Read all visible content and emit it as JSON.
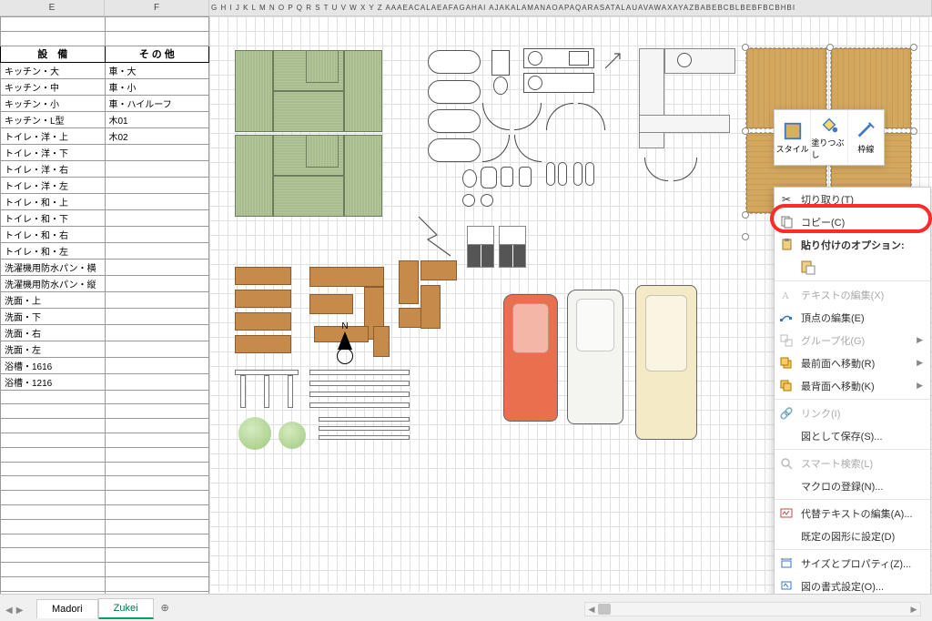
{
  "columns": {
    "E": "E",
    "F": "F",
    "narrow": [
      "G",
      "H",
      "I",
      "J",
      "K",
      "L",
      "M",
      "N",
      "O",
      "P",
      "Q",
      "R",
      "S",
      "T",
      "U",
      "V",
      "W",
      "X",
      "Y",
      "Z",
      "AA",
      "",
      "",
      "",
      "",
      "AE",
      "",
      "",
      "",
      "",
      "",
      "AA",
      "",
      "",
      "",
      "",
      "",
      "",
      "",
      "",
      "",
      "",
      "",
      "",
      "",
      "",
      "",
      "",
      "",
      "",
      "",
      "",
      "",
      "",
      "",
      "",
      "",
      "",
      "",
      "",
      "",
      "",
      "",
      "",
      "",
      "",
      "",
      "AZ",
      "",
      "",
      "",
      "",
      "",
      "",
      "",
      "",
      "",
      "BE",
      "",
      "",
      "",
      "",
      "",
      "",
      "",
      ""
    ]
  },
  "col_letters_raw": "G H I  J K L M N O P Q R S T U V W X Y Z  AAAEACALAEAFAGAHAI AJAKALAMANAOAPAQARASATALAUAVAWAXAYAZBABEBCBLBEBFBCBHBI",
  "table": {
    "headers": [
      "設　備",
      "そ の 他"
    ],
    "rows": [
      [
        "キッチン・大",
        "車・大"
      ],
      [
        "キッチン・中",
        "車・小"
      ],
      [
        "キッチン・小",
        "車・ハイルーフ"
      ],
      [
        "キッチン・L型",
        "木01"
      ],
      [
        "トイレ・洋・上",
        "木02"
      ],
      [
        "トイレ・洋・下",
        ""
      ],
      [
        "トイレ・洋・右",
        ""
      ],
      [
        "トイレ・洋・左",
        ""
      ],
      [
        "トイレ・和・上",
        ""
      ],
      [
        "トイレ・和・下",
        ""
      ],
      [
        "トイレ・和・右",
        ""
      ],
      [
        "トイレ・和・左",
        ""
      ],
      [
        "洗濯機用防水パン・横",
        ""
      ],
      [
        "洗濯機用防水パン・縦",
        ""
      ],
      [
        "洗面・上",
        ""
      ],
      [
        "洗面・下",
        ""
      ],
      [
        "洗面・右",
        ""
      ],
      [
        "洗面・左",
        ""
      ],
      [
        "浴槽・1616",
        ""
      ],
      [
        "浴槽・1216",
        ""
      ]
    ]
  },
  "mini_toolbar": {
    "style": "スタイル",
    "fill": "塗りつぶし",
    "border": "枠線"
  },
  "context_menu": {
    "cut": "切り取り(T)",
    "copy": "コピー(C)",
    "paste_options": "貼り付けのオプション:",
    "edit_text": "テキストの編集(X)",
    "edit_points": "頂点の編集(E)",
    "group": "グループ化(G)",
    "bring_front": "最前面へ移動(R)",
    "send_back": "最背面へ移動(K)",
    "link": "リンク(I)",
    "save_as_picture": "図として保存(S)...",
    "smart_lookup": "スマート検索(L)",
    "assign_macro": "マクロの登録(N)...",
    "alt_text": "代替テキストの編集(A)...",
    "set_default": "既定の図形に設定(D)",
    "size_props": "サイズとプロパティ(Z)...",
    "format_shape": "図の書式設定(O)..."
  },
  "compass": {
    "label": "N"
  },
  "tabs": {
    "madori": "Madori",
    "zukei": "Zukei",
    "add": "⊕"
  },
  "tabs_nav": {
    "prev": "◀",
    "next": "▶"
  }
}
